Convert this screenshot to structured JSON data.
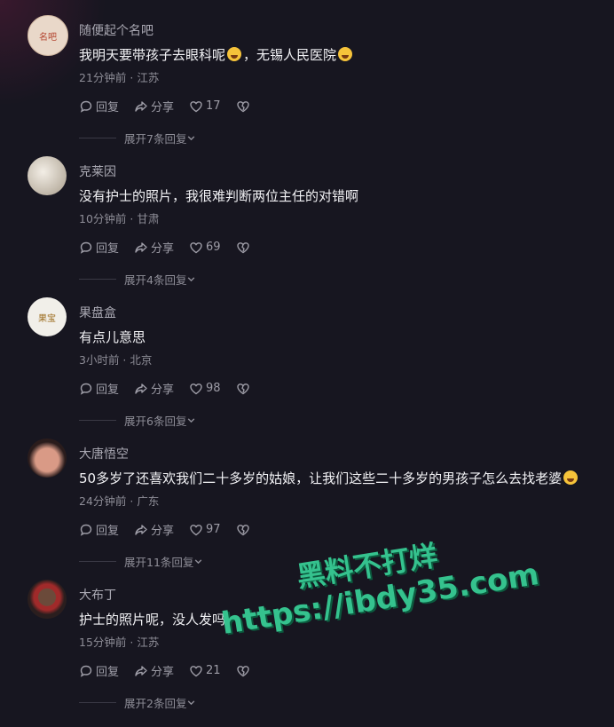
{
  "comments": [
    {
      "user": "随便起个名吧",
      "text_a": "我明天要带孩子去眼科呢",
      "text_b": "，无锡人民医院",
      "emoji": true,
      "meta": "21分钟前 · 江苏",
      "reply": "回复",
      "share": "分享",
      "likes": "17",
      "expand": "展开7条回复",
      "avatar_color": "#e9d8c9",
      "avatar_text": "名吧"
    },
    {
      "user": "克莱因",
      "text_a": "没有护士的照片，我很难判断两位主任的对错啊",
      "text_b": "",
      "emoji": false,
      "meta": "10分钟前 · 甘肃",
      "reply": "回复",
      "share": "分享",
      "likes": "69",
      "expand": "展开4条回复",
      "avatar_color": "#cfc6b8",
      "avatar_text": ""
    },
    {
      "user": "果盘盒",
      "text_a": "有点儿意思",
      "text_b": "",
      "emoji": false,
      "meta": "3小时前 · 北京",
      "reply": "回复",
      "share": "分享",
      "likes": "98",
      "expand": "展开6条回复",
      "avatar_color": "#f1efe9",
      "avatar_text": "果宝"
    },
    {
      "user": "大唐悟空",
      "text_a": "50多岁了还喜欢我们二十多岁的姑娘，让我们这些二十多岁的男孩子怎么去找老婆",
      "text_b": "",
      "emoji": true,
      "meta": "24分钟前 · 广东",
      "reply": "回复",
      "share": "分享",
      "likes": "97",
      "expand": "展开11条回复",
      "avatar_color": "#c0796b",
      "avatar_text": ""
    },
    {
      "user": "大布丁",
      "text_a": "护士的照片呢，没人发吗",
      "text_b": "",
      "emoji": false,
      "meta": "15分钟前 · 江苏",
      "reply": "回复",
      "share": "分享",
      "likes": "21",
      "expand": "展开2条回复",
      "avatar_color": "#3a2a2a",
      "avatar_text": ""
    }
  ],
  "watermark": {
    "line1": "黑料不打烊",
    "line2": "https://ibdy35.com"
  }
}
